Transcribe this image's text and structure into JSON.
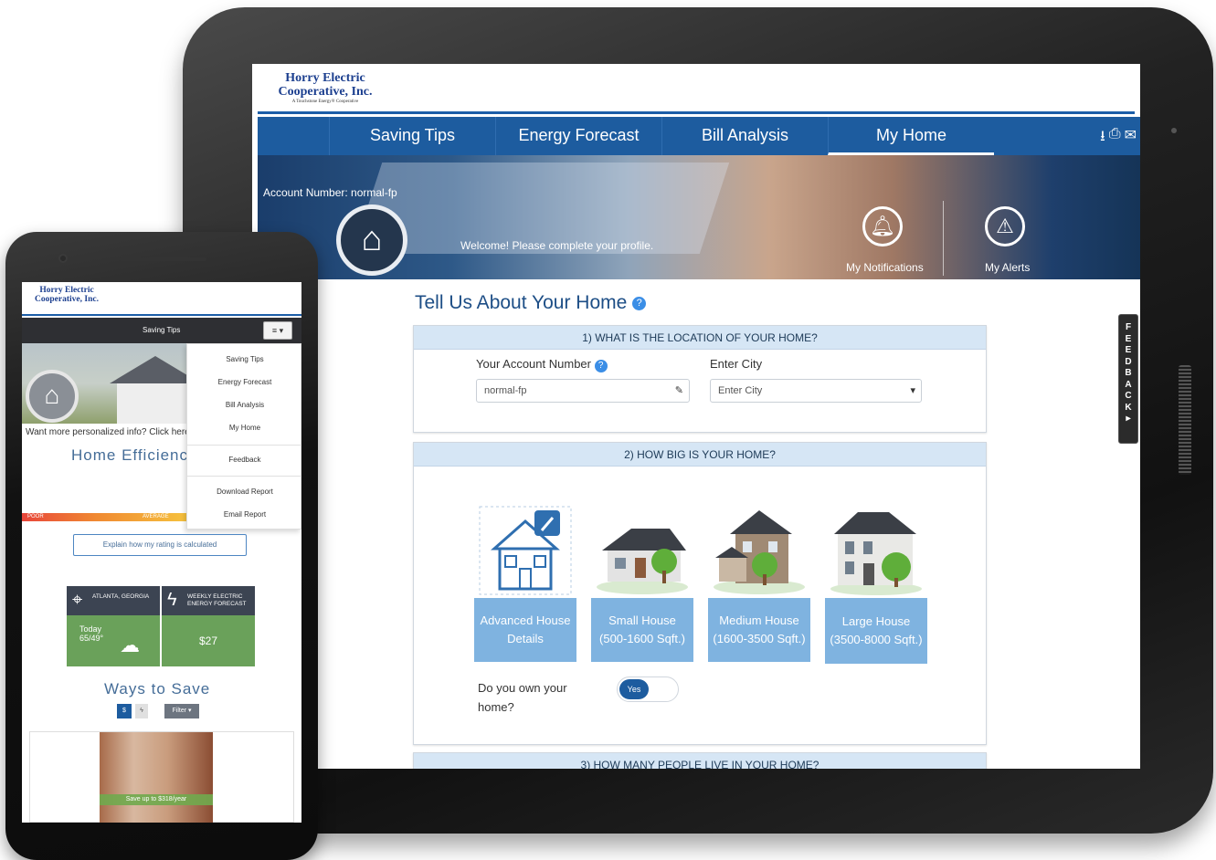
{
  "tablet": {
    "logo": {
      "line1": "Horry Electric",
      "line2": "Cooperative, Inc.",
      "tagline": "A Touchstone Energy® Cooperative"
    },
    "nav": {
      "tabs": [
        {
          "label": "Saving Tips"
        },
        {
          "label": "Energy Forecast"
        },
        {
          "label": "Bill Analysis"
        },
        {
          "label": "My Home",
          "active": true
        }
      ],
      "actions": {
        "download": "⭳",
        "print": "⎙",
        "email": "✉"
      }
    },
    "hero": {
      "account": "Account Number: normal-fp",
      "welcome": "Welcome! Please complete your profile.",
      "notifications_label": "My Notifications",
      "alerts_label": "My Alerts"
    },
    "page_title": "Tell Us About Your Home",
    "section1": {
      "header": "1) WHAT IS THE LOCATION OF YOUR HOME?",
      "account_label": "Your Account Number",
      "account_value": "normal-fp",
      "city_label": "Enter City",
      "city_placeholder": "Enter City"
    },
    "section2": {
      "header": "2) HOW BIG IS YOUR HOME?",
      "options": [
        {
          "label": "Advanced House Details"
        },
        {
          "label": "Small House (500-1600 Sqft.)"
        },
        {
          "label": "Medium House (1600-3500 Sqft.)"
        },
        {
          "label": "Large House (3500-8000 Sqft.)"
        }
      ],
      "own_label": "Do you own your home?",
      "own_value": "Yes"
    },
    "section3": {
      "header": "3) HOW MANY PEOPLE LIVE IN YOUR HOME?"
    },
    "feedback": "FEEDBACK"
  },
  "phone": {
    "logo": {
      "line1": "Horry Electric",
      "line2": "Cooperative, Inc."
    },
    "nav_current": "Saving Tips",
    "menu_icon": "≡ ▾",
    "menu": {
      "items": [
        "Saving Tips",
        "Energy Forecast",
        "Bill Analysis",
        "My Home"
      ],
      "feedback": "Feedback",
      "report_items": [
        "Download Report",
        "Email Report"
      ]
    },
    "more_info": "Want more personalized info? Click here!",
    "efficiency_title": "Home Efficienc",
    "rating": {
      "poor": "POOR",
      "average": "AVERAGE"
    },
    "explain": "Explain how my rating is calculated",
    "tiles": {
      "location": "ATLANTA, GEORGIA",
      "today": "Today",
      "temp": "65/49°",
      "forecast_title": "WEEKLY ELECTRIC ENERGY FORECAST",
      "forecast_value": "$27"
    },
    "ways_title": "Ways to Save",
    "filter_dollar": "$",
    "filter_label": "Filter ▾",
    "card_caption": "Save up to $318/year"
  },
  "colors": {
    "brand_blue": "#1d5c9f",
    "option_blue": "#7fb3e0",
    "tile_green": "#6aa15a"
  }
}
